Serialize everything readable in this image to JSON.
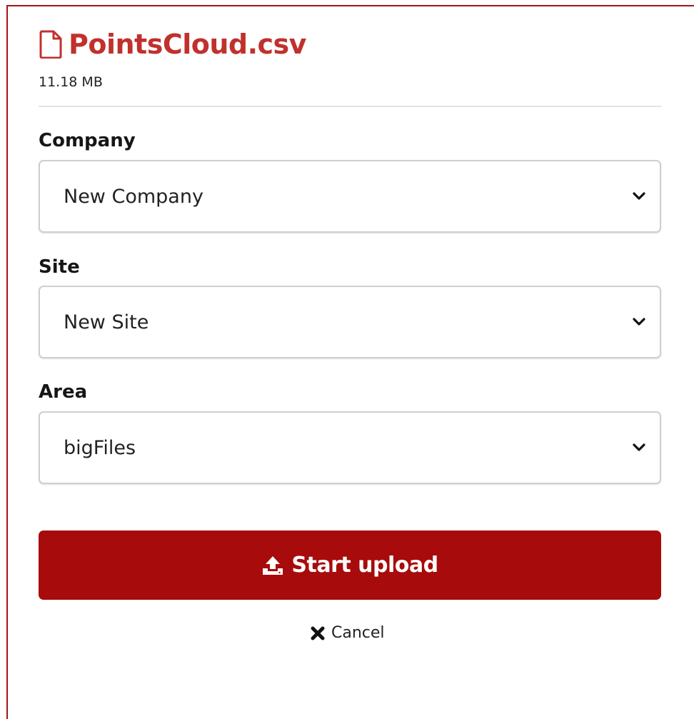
{
  "file": {
    "name": "PointsCloud.csv",
    "size": "11.18 MB",
    "icon": "file-icon"
  },
  "fields": {
    "company": {
      "label": "Company",
      "value": "New Company"
    },
    "site": {
      "label": "Site",
      "value": "New Site"
    },
    "area": {
      "label": "Area",
      "value": "bigFiles"
    }
  },
  "actions": {
    "upload_label": "Start upload",
    "upload_icon": "upload-icon",
    "cancel_label": "Cancel",
    "cancel_icon": "close-icon"
  },
  "colors": {
    "accent": "#a80b0b",
    "title": "#c0312d",
    "frame": "#a31515"
  }
}
